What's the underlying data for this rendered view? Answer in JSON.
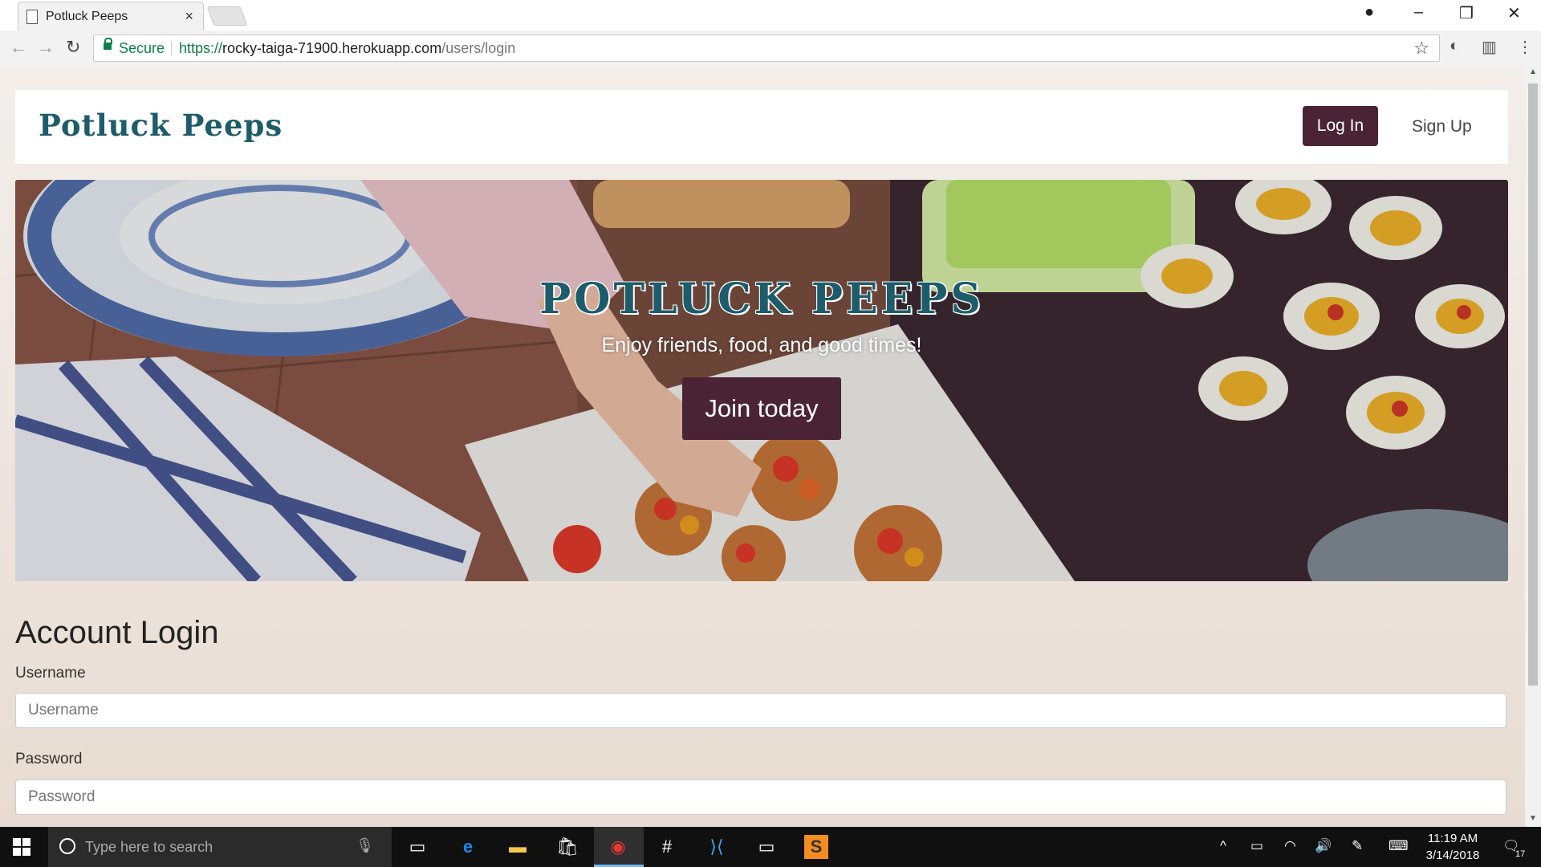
{
  "browser": {
    "tab_title": "Potluck Peeps",
    "tab_close": "×",
    "secure_label": "Secure",
    "url_scheme": "https://",
    "url_host": "rocky-taiga-71900.herokuapp.com",
    "url_path": "/users/login"
  },
  "navbar": {
    "brand": "Potluck Peeps",
    "login_label": "Log In",
    "signup_label": "Sign Up"
  },
  "hero": {
    "title": "POTLUCK PEEPS",
    "subtitle": "Enjoy friends, food, and good times!",
    "cta_label": "Join today"
  },
  "login_form": {
    "heading": "Account Login",
    "username_label": "Username",
    "username_placeholder": "Username",
    "password_label": "Password",
    "password_placeholder": "Password"
  },
  "taskbar": {
    "search_placeholder": "Type here to search",
    "time": "11:19 AM",
    "date": "3/14/2018",
    "notification_count": "17"
  },
  "colors": {
    "brand_teal": "#1d5c6b",
    "button_plum": "#4a2435",
    "secure_green": "#0b8043"
  }
}
